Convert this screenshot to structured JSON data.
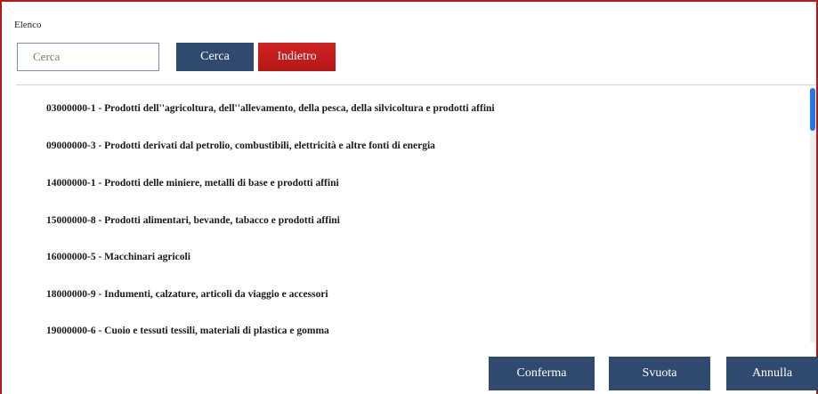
{
  "panel": {
    "title": "Elenco"
  },
  "search": {
    "placeholder": "Cerca",
    "button_label": "Cerca",
    "back_label": "Indietro"
  },
  "list": {
    "items": [
      {
        "label": "03000000-1 - Prodotti dell''agricoltura, dell''allevamento, della pesca, della silvicoltura e prodotti affini"
      },
      {
        "label": "09000000-3 - Prodotti derivati dal petrolio, combustibili, elettricità e altre fonti di energia"
      },
      {
        "label": "14000000-1 - Prodotti delle miniere, metalli di base e prodotti affini"
      },
      {
        "label": "15000000-8 - Prodotti alimentari, bevande, tabacco e prodotti affini"
      },
      {
        "label": "16000000-5 - Macchinari agricoli"
      },
      {
        "label": "18000000-9 - Indumenti, calzature, articoli da viaggio e accessori"
      },
      {
        "label": "19000000-6 - Cuoio e tessuti tessili, materiali di plastica e gomma"
      }
    ]
  },
  "footer": {
    "confirm_label": "Conferma",
    "clear_label": "Svuota",
    "cancel_label": "Annulla"
  },
  "colors": {
    "primary": "#2f4a6e",
    "danger": "#c41e1e",
    "frame": "#b01c1c",
    "scroll_thumb": "#1e7be3"
  }
}
